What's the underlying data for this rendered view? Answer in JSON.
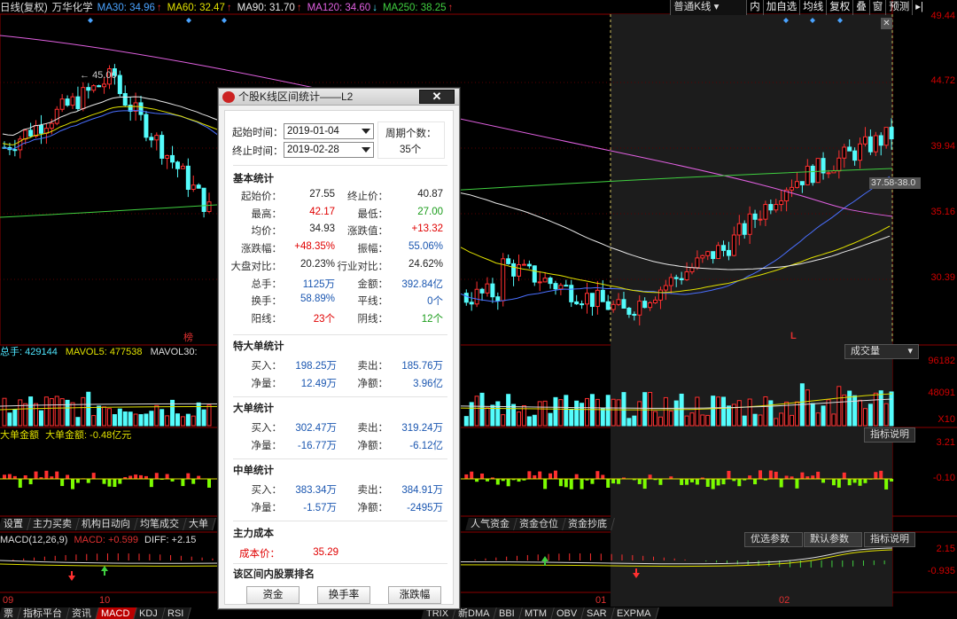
{
  "header": {
    "title": "日线(复权)",
    "stock": "万华化学",
    "ma": [
      {
        "label": "MA30: 34.96",
        "dir": "↑",
        "color": "#4aa3ff"
      },
      {
        "label": "MA60: 32.47",
        "dir": "↑",
        "color": "#e0e000"
      },
      {
        "label": "MA90: 31.70",
        "dir": "↑",
        "color": "#e8e8e8"
      },
      {
        "label": "MA120: 34.60",
        "dir": "↓",
        "color": "#e060e0"
      },
      {
        "label": "MA250: 38.25",
        "dir": "↑",
        "color": "#40d040"
      }
    ]
  },
  "toolbar": {
    "kline_type": "普通K线",
    "items": [
      "内",
      "加自选",
      "均线",
      "复权",
      "叠",
      "窗",
      "预测"
    ]
  },
  "price_axis": [
    "49.44",
    "44.72",
    "39.94",
    "35.16",
    "30.39"
  ],
  "price_tag": "37.58-38.0",
  "chart_marks": {
    "high_label": "45.00",
    "l_marker": "L",
    "bottom_marker": "榜"
  },
  "volume": {
    "label": "总手: 429144",
    "mavol5": "MAVOL5: 477538",
    "mavol30": "MAVOL30:",
    "dropdown": "成交量",
    "axis": [
      "96182",
      "48091"
    ],
    "unit": "X10"
  },
  "big_order": {
    "label": "大单金额",
    "value": "大单金额: -0.48亿元",
    "button": "指标说明",
    "axis": [
      "3.21",
      "-0.10"
    ]
  },
  "tabs1": [
    "设置",
    "主力买卖",
    "机构日动向",
    "均笔成交",
    "大单",
    "人气资金",
    "资金仓位",
    "资金抄底"
  ],
  "macd": {
    "label": "MACD(12,26,9)",
    "macd": "MACD: +0.599",
    "diff": "DIFF: +2.15",
    "buttons": [
      "优选参数",
      "默认参数",
      "指标说明"
    ],
    "axis": [
      "2.15",
      "-0.935"
    ]
  },
  "x_axis": [
    "09",
    "10",
    "01",
    "02"
  ],
  "tabs2": [
    "票",
    "指标平台",
    "资讯",
    "MACD",
    "KDJ",
    "RSI",
    "TRIX",
    "新DMA",
    "BBI",
    "MTM",
    "OBV",
    "SAR",
    "EXPMA"
  ],
  "dialog": {
    "title": "个股K线区间统计——L2",
    "start_label": "起始时间：",
    "start_value": "2019-01-04",
    "end_label": "终止时间：",
    "end_value": "2019-02-28",
    "period_label": "周期个数：",
    "period_value": "35个",
    "basic_title": "基本统计",
    "basic": [
      [
        "起始价：",
        "27.55",
        "",
        "终止价：",
        "40.87",
        ""
      ],
      [
        "最高：",
        "42.17",
        "red",
        "最低：",
        "27.00",
        "green"
      ],
      [
        "均价：",
        "34.93",
        "",
        "涨跌值：",
        "+13.32",
        "red"
      ],
      [
        "涨跌幅：",
        "+48.35%",
        "red",
        "振幅：",
        "55.06%",
        "blue"
      ],
      [
        "大盘对比：",
        "20.23%",
        "",
        "行业对比：",
        "24.62%",
        ""
      ],
      [
        "总手：",
        "1125万",
        "blue",
        "金额：",
        "392.84亿",
        "blue"
      ],
      [
        "换手：",
        "58.89%",
        "blue",
        "平线：",
        "0个",
        "blue"
      ],
      [
        "阳线：",
        "23个",
        "red",
        "阴线：",
        "12个",
        "green"
      ]
    ],
    "xl_title": "特大单统计",
    "xl": [
      [
        "买入：",
        "198.25万",
        "卖出：",
        "185.76万"
      ],
      [
        "净量：",
        "12.49万",
        "净额：",
        "3.96亿"
      ]
    ],
    "l_title": "大单统计",
    "l": [
      [
        "买入：",
        "302.47万",
        "卖出：",
        "319.24万"
      ],
      [
        "净量：",
        "-16.77万",
        "净额：",
        "-6.12亿"
      ]
    ],
    "m_title": "中单统计",
    "m": [
      [
        "买入：",
        "383.34万",
        "卖出：",
        "384.91万"
      ],
      [
        "净量：",
        "-1.57万",
        "净额：",
        "-2495万"
      ]
    ],
    "cost_title": "主力成本",
    "cost_label": "成本价：",
    "cost_value": "35.29",
    "rank_title": "该区间内股票排名",
    "rank_buttons": [
      "资金",
      "换手率",
      "涨跌幅"
    ]
  }
}
